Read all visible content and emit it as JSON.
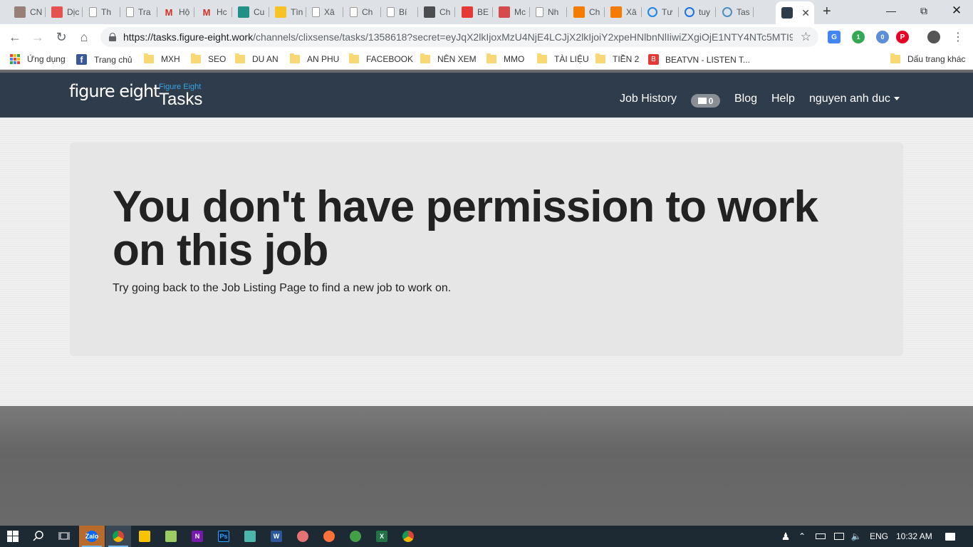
{
  "browser": {
    "tabs": [
      {
        "label": "CN",
        "icon": "certificate-icon",
        "color": "#8d6e63"
      },
      {
        "label": "Dịc",
        "icon": "idvs-icon",
        "color": "#e53935"
      },
      {
        "label": "Th",
        "icon": "page-icon",
        "color": "#999999"
      },
      {
        "label": "Tra",
        "icon": "page-icon",
        "color": "#999999"
      },
      {
        "label": "Hộ",
        "icon": "gmail-icon",
        "color": "#d93025"
      },
      {
        "label": "Hc",
        "icon": "gmail-icon",
        "color": "#d93025"
      },
      {
        "label": "Cu",
        "icon": "bing-icon",
        "color": "#008373"
      },
      {
        "label": "Tìn",
        "icon": "google-ads-icon",
        "color": "#fbbc04"
      },
      {
        "label": "Xâ",
        "icon": "page-icon",
        "color": "#999999"
      },
      {
        "label": "Ch",
        "icon": "page-icon",
        "color": "#999999"
      },
      {
        "label": "Bí",
        "icon": "page-icon",
        "color": "#999999"
      },
      {
        "label": "Ch",
        "icon": "asterisk-icon",
        "color": "#333333"
      },
      {
        "label": "BE",
        "icon": "beatvn-icon",
        "color": "#e53935"
      },
      {
        "label": "Mc",
        "icon": "v-icon",
        "color": "#d32f2f"
      },
      {
        "label": "Nh",
        "icon": "page-icon",
        "color": "#999999"
      },
      {
        "label": "Ch",
        "icon": "rss-icon",
        "color": "#f57c00"
      },
      {
        "label": "Xâ",
        "icon": "rss-icon",
        "color": "#f57c00"
      },
      {
        "label": "Tư",
        "icon": "s-circle-icon",
        "color": "#1e88e5"
      },
      {
        "label": "tuy",
        "icon": "loading-icon",
        "color": "#1a73e8"
      },
      {
        "label": "Tas",
        "icon": "moon-icon",
        "color": "#4a8fc0"
      },
      {
        "label": "",
        "icon": "figure-eight-icon",
        "color": "#2f3c4b",
        "active": true
      }
    ],
    "url_host": "https://tasks.figure-eight.work",
    "url_rest": "/channels/clixsense/tasks/1358618?secret=eyJqX2lkIjoxMzU4NjE4LCJjX2lkIjoiY2xpeHNlbnNlIiwiZXgiOjE1NTY4NTc5MTI9...",
    "extensions": {
      "ext2_badge": "1",
      "ext3_badge": "0"
    },
    "bookmarks": [
      {
        "label": "Ứng dụng",
        "type": "apps"
      },
      {
        "label": "Trang chủ",
        "type": "facebook"
      },
      {
        "label": "MXH",
        "type": "folder"
      },
      {
        "label": "SEO",
        "type": "folder"
      },
      {
        "label": "DU AN",
        "type": "folder"
      },
      {
        "label": "AN PHU",
        "type": "folder"
      },
      {
        "label": "FACEBOOK",
        "type": "folder"
      },
      {
        "label": "NÊN XEM",
        "type": "folder"
      },
      {
        "label": "MMO",
        "type": "folder"
      },
      {
        "label": "TÀI LIỆU",
        "type": "folder"
      },
      {
        "label": "TIỀN 2",
        "type": "folder"
      },
      {
        "label": "BEATVN - LISTEN T...",
        "type": "beatvn"
      }
    ],
    "other_bookmarks": "Dấu trang khác"
  },
  "site": {
    "logo": "figure eight",
    "logo_sub": "Figure Eight",
    "logo_product": "Tasks",
    "nav": {
      "job_history": "Job History",
      "messages_count": "0",
      "blog": "Blog",
      "help": "Help",
      "user": "nguyen anh duc"
    }
  },
  "main": {
    "heading": "You don't have permission to work on this job",
    "subtext": "Try going back to the Job Listing Page to find a new job to work on."
  },
  "taskbar": {
    "lang": "ENG",
    "time": "10:32 AM"
  }
}
